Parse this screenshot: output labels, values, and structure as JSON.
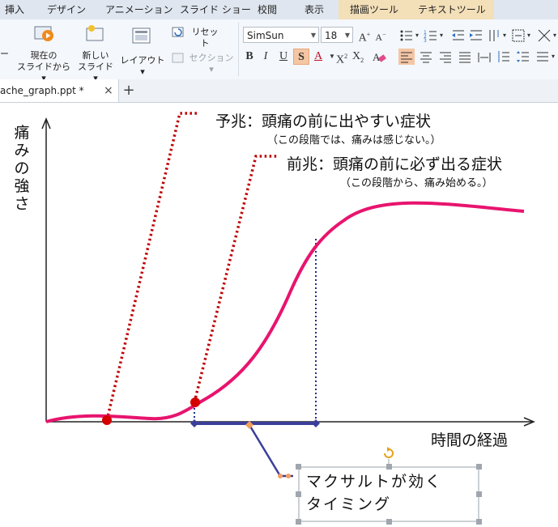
{
  "ribbon_tabs": [
    "挿入",
    "デザイン",
    "アニメーション",
    "スライド ショー",
    "校閲",
    "表示",
    "描画ツール",
    "テキストツール"
  ],
  "ribbon": {
    "current_slide_line1": "現在の",
    "current_slide_line2": "スライドから",
    "new_slide_line1": "新しい",
    "new_slide_line2": "スライド",
    "layout": "レイアウト",
    "reset": "リセット",
    "section": "セクション",
    "font_name": "SimSun",
    "font_size": "18"
  },
  "doc_tab": {
    "name": "ache_graph.ppt *",
    "close": "×",
    "new": "+"
  },
  "slide": {
    "y_axis_label": "痛みの強さ",
    "x_axis_label": "時間の経過",
    "prodrome_title": "予兆：頭痛の前に出やすい症状",
    "prodrome_sub": "（この段階では、痛みは感じない。）",
    "aura_title": "前兆：頭痛の前に必ず出る症状",
    "aura_sub": "（この段階から、痛み始める。）",
    "callout_line1": "マクサルトが効く",
    "callout_line2": "タイミング"
  },
  "colors": {
    "curve": "#e8146e",
    "dotted_red": "#c00000",
    "dotted_blue": "#1f2f8a",
    "window_bar": "#3b3f9a",
    "marker_red": "#d40000",
    "context_tab": "#f3dfb8"
  }
}
